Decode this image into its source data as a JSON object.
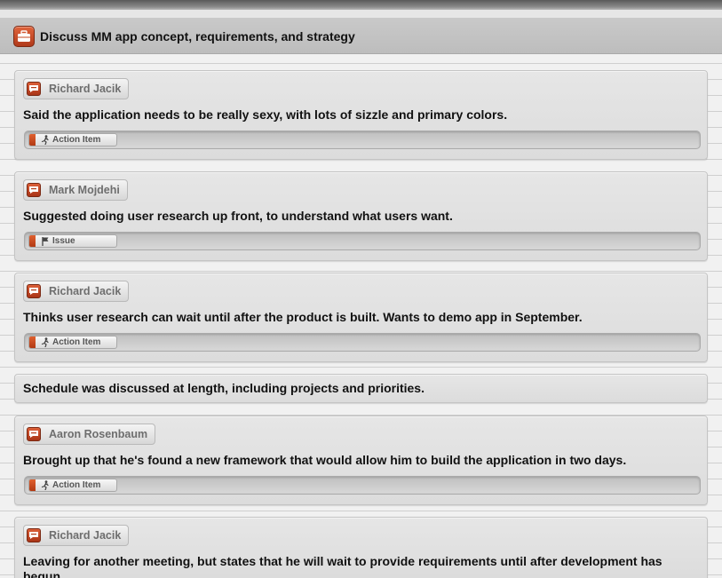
{
  "topic": {
    "title": "Discuss MM app concept, requirements, and strategy",
    "icon": "briefcase-icon",
    "accent": "#c4471f"
  },
  "notes": [
    {
      "author": "Richard Jacik",
      "text": "Said the application needs to be really sexy, with lots of sizzle and primary colors.",
      "tag": {
        "label": "Action Item",
        "icon": "running-person-icon"
      }
    },
    {
      "author": "Mark Mojdehi",
      "text": "Suggested doing user research up front, to understand what users want.",
      "tag": {
        "label": "Issue",
        "icon": "flag-icon"
      }
    },
    {
      "author": "Richard Jacik",
      "text": "Thinks user research can wait until after the product is built. Wants to demo app in September.",
      "tag": {
        "label": "Action Item",
        "icon": "running-person-icon"
      }
    },
    {
      "author": "",
      "text": "Schedule was discussed at length, including projects and priorities.",
      "tag": null
    },
    {
      "author": "Aaron Rosenbaum",
      "text": "Brought up that he's found a new framework that would allow him to build the application in two days.",
      "tag": {
        "label": "Action Item",
        "icon": "running-person-icon"
      }
    },
    {
      "author": "Richard Jacik",
      "text": "Leaving for another meeting, but states that he will wait to provide requirements until after development has begun.",
      "tag": null
    }
  ]
}
